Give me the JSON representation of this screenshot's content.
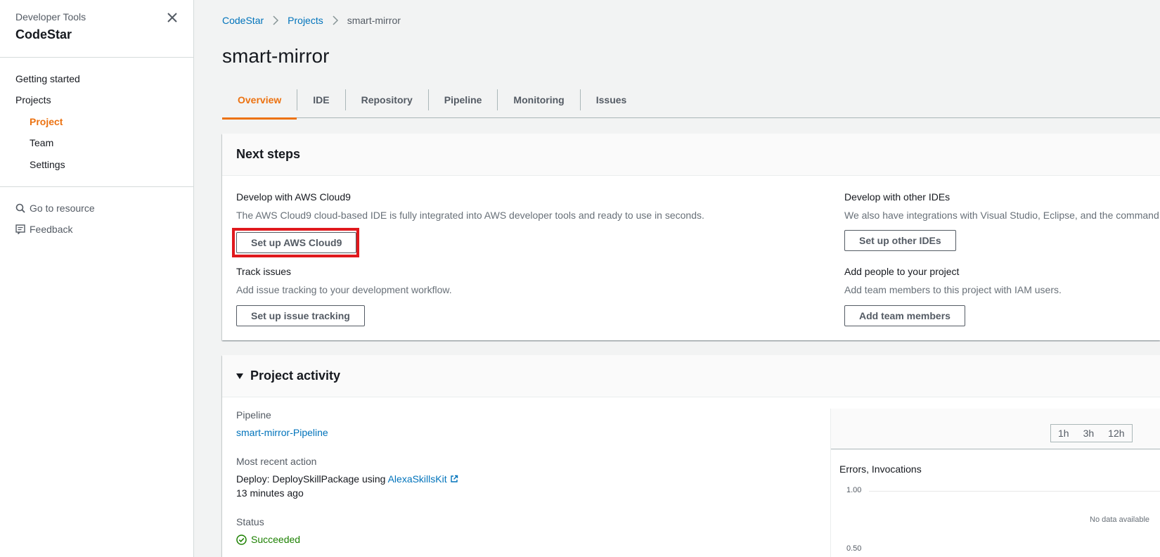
{
  "sidebar": {
    "subtitle": "Developer Tools",
    "title": "CodeStar",
    "nav": {
      "getting_started": "Getting started",
      "projects": "Projects",
      "project": "Project",
      "team": "Team",
      "settings": "Settings"
    },
    "go_to_resource": "Go to resource",
    "feedback": "Feedback"
  },
  "breadcrumb": {
    "items": [
      "CodeStar",
      "Projects"
    ],
    "current": "smart-mirror"
  },
  "page_title": "smart-mirror",
  "tabs": [
    "Overview",
    "IDE",
    "Repository",
    "Pipeline",
    "Monitoring",
    "Issues"
  ],
  "next_steps": {
    "title": "Next steps",
    "cloud9": {
      "label": "Develop with AWS Cloud9",
      "desc": "The AWS Cloud9 cloud-based IDE is fully integrated into AWS developer tools and ready to use in seconds.",
      "button": "Set up AWS Cloud9"
    },
    "other_ides": {
      "label": "Develop with other IDEs",
      "desc": "We also have integrations with Visual Studio, Eclipse, and the command line.",
      "button": "Set up other IDEs"
    },
    "issues": {
      "label": "Track issues",
      "desc": "Add issue tracking to your development workflow.",
      "button": "Set up issue tracking"
    },
    "people": {
      "label": "Add people to your project",
      "desc": "Add team members to this project with IAM users.",
      "button": "Add team members"
    }
  },
  "activity": {
    "title": "Project activity",
    "pipeline_label": "Pipeline",
    "pipeline_link": "smart-mirror-Pipeline",
    "recent_label": "Most recent action",
    "recent_text": "Deploy: DeploySkillPackage using",
    "recent_link": "AlexaSkillsKit",
    "recent_time": "13 minutes ago",
    "status_label": "Status",
    "status_value": "Succeeded",
    "chart": {
      "ranges": [
        "1h",
        "3h",
        "12h"
      ],
      "title": "Errors, Invocations",
      "y_ticks": [
        "1.00",
        "0.50"
      ],
      "no_data": "No data available"
    }
  },
  "colors": {
    "accent": "#ec7211",
    "link": "#0073bb",
    "success": "#1d8102",
    "highlight": "#e0191d"
  }
}
